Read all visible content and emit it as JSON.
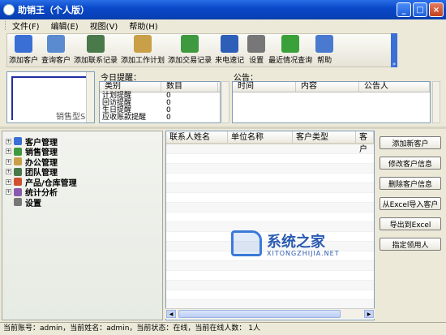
{
  "window": {
    "title": "助销王（个人版）"
  },
  "menu": [
    "文件(F)",
    "编辑(E)",
    "视图(V)",
    "帮助(H)"
  ],
  "toolbar": [
    {
      "label": "添加客户",
      "icon": "add-customer-icon",
      "color": "#3a6fd6"
    },
    {
      "label": "查询客户",
      "icon": "search-customer-icon",
      "color": "#5a8ad0"
    },
    {
      "label": "添加联系记录",
      "icon": "contact-record-icon",
      "color": "#4a7a4a"
    },
    {
      "label": "添加工作计划",
      "icon": "work-plan-icon",
      "color": "#c9a048"
    },
    {
      "label": "添加交易记录",
      "icon": "trade-record-icon",
      "color": "#3f9a3f"
    },
    {
      "label": "来电速记",
      "icon": "call-note-icon",
      "color": "#2e5fb8"
    },
    {
      "label": "设置",
      "icon": "settings-icon",
      "color": "#777777"
    },
    {
      "label": "最近情况查询",
      "icon": "recent-query-icon",
      "color": "#3aa13a"
    },
    {
      "label": "帮助",
      "icon": "help-icon",
      "color": "#4a7ad0"
    }
  ],
  "preview": {
    "text": "销售型S"
  },
  "reminder": {
    "title": "今日提醒：",
    "columns": [
      "类别",
      "数目"
    ],
    "rows": [
      [
        "计划提醒",
        "0"
      ],
      [
        "回访提醒",
        "0"
      ],
      [
        "生日提醒",
        "0"
      ],
      [
        "应收账款提醒",
        "0"
      ]
    ]
  },
  "notice": {
    "title": "公告：",
    "columns": [
      "时间",
      "内容",
      "公告人"
    ]
  },
  "tree": [
    {
      "label": "客户管理",
      "color": "#3a6fd6"
    },
    {
      "label": "销售管理",
      "color": "#3f9a3f"
    },
    {
      "label": "办公管理",
      "color": "#c9a048"
    },
    {
      "label": "团队管理",
      "color": "#4a7a4a"
    },
    {
      "label": "产品/仓库管理",
      "color": "#d05030"
    },
    {
      "label": "统计分析",
      "color": "#8a5ab0"
    },
    {
      "label": "设置",
      "color": "#777777"
    }
  ],
  "list": {
    "columns": [
      "联系人姓名",
      "单位名称",
      "客户类型",
      "客户"
    ]
  },
  "actions": [
    "添加新客户",
    "修改客户信息",
    "删除客户信息",
    "从Excel导入客户",
    "导出到Excel",
    "指定领用人"
  ],
  "watermark": {
    "big": "系统之家",
    "small": "XITONGZHIJIA.NET"
  },
  "status": "当前账号：admin，当前姓名：admin，当前状态：在线，当前在线人数： 1人"
}
